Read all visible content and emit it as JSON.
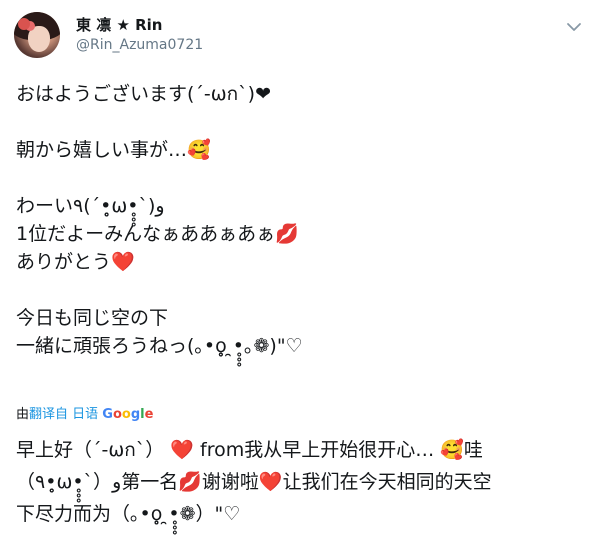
{
  "user": {
    "display_name": "東 凛 ★ Rin",
    "handle": "@Rin_Azuma0721"
  },
  "tweet": {
    "lines": [
      "おはようございます(´-ωก`)❤",
      "",
      "朝から嬉しい事が…🥰",
      "",
      "わーい٩(´•̥̥̥ω•̥̥̥`)و",
      "1位だよーみんなぁああぁあぁ💋",
      "ありがとう❤️",
      "",
      "今日も同じ空の下",
      "一緒に頑張ろうねっ(｡•o̥̥̥ ̯•̥̥̥｡❁)\"♡"
    ]
  },
  "translation": {
    "prefix": "由",
    "link_label": "翻译自 日语",
    "provider": "Google",
    "lines": [
      "早上好（´-ωก`） ❤️ from我从早上开始很开心… 🥰哇",
      "（٩•̥̥̥ω•̥̥̥`）و第一名💋谢谢啦❤️让我们在今天相同的天空",
      "下尽力而为（｡•o̥̥̥ ̯•̥̥̥❁）\"♡"
    ]
  },
  "colors": {
    "text": "#14171a",
    "secondary": "#657786",
    "link": "#1b95e0",
    "google_blue": "#4285f4",
    "google_red": "#ea4335",
    "google_yellow": "#fbbc05",
    "google_green": "#34a853"
  },
  "icons": {
    "menu": "chevron-down-icon"
  }
}
